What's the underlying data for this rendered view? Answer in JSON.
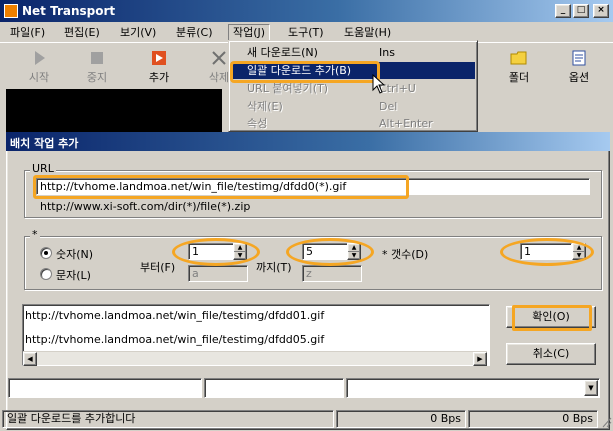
{
  "window": {
    "title": "Net Transport",
    "controls": {
      "minimize": "_",
      "maximize": "□",
      "close": "×"
    }
  },
  "menubar": {
    "items": [
      "파일(F)",
      "편집(E)",
      "보기(V)",
      "분류(C)",
      "작업(J)",
      "도구(T)",
      "도움말(H)"
    ]
  },
  "toolbar": {
    "items": [
      {
        "label": "시작",
        "icon": "play-icon",
        "enabled": false
      },
      {
        "label": "중지",
        "icon": "stop-icon",
        "enabled": false
      },
      {
        "label": "추가",
        "icon": "add-icon",
        "enabled": true
      },
      {
        "label": "삭제",
        "icon": "delete-icon",
        "enabled": false
      },
      {
        "label": "폴더",
        "icon": "folder-icon",
        "enabled": true
      },
      {
        "label": "옵션",
        "icon": "options-icon",
        "enabled": true
      }
    ]
  },
  "dropdown": {
    "items": [
      {
        "label": "새 다운로드(N)",
        "shortcut": "Ins",
        "state": "normal"
      },
      {
        "label": "일괄 다운로드 추가(B)",
        "shortcut": "",
        "state": "selected"
      },
      {
        "label": "URL 붙여넣기(T)",
        "shortcut": "Ctrl+U",
        "state": "disabled"
      },
      {
        "label": "삭제(E)",
        "shortcut": "Del",
        "state": "disabled"
      },
      {
        "label": "속성",
        "shortcut": "Alt+Enter",
        "state": "disabled"
      }
    ]
  },
  "dialog": {
    "title": "배치 작업 추가",
    "url_group_label": "URL",
    "url_value": "http://tvhome.landmoa.net/win_file/testimg/dfdd0(*).gif",
    "url_example": "http://www.xi-soft.com/dir(*)/file(*).zip",
    "wildcard_group_label": "*",
    "radio_number": "숫자(N)",
    "radio_letter": "문자(L)",
    "from_label": "부터(F)",
    "to_label": "까지(T)",
    "count_label": "* 갯수(D)",
    "from_number": "1",
    "to_number": "5",
    "count_value": "1",
    "from_letter": "a",
    "to_letter": "z",
    "results": [
      "http://tvhome.landmoa.net/win_file/testimg/dfdd01.gif",
      "http://tvhome.landmoa.net/win_file/testimg/dfdd05.gif"
    ],
    "ok_button": "확인(O)",
    "cancel_button": "취소(C)"
  },
  "statusbar": {
    "message": "일괄 다운로드를 추가합니다",
    "speed_down": "0 Bps",
    "speed_up": "0 Bps"
  },
  "colors": {
    "highlight": "#f5a623",
    "title_gradient_start": "#0a246a",
    "selection": "#0a246a",
    "face": "#d4d0c8"
  }
}
